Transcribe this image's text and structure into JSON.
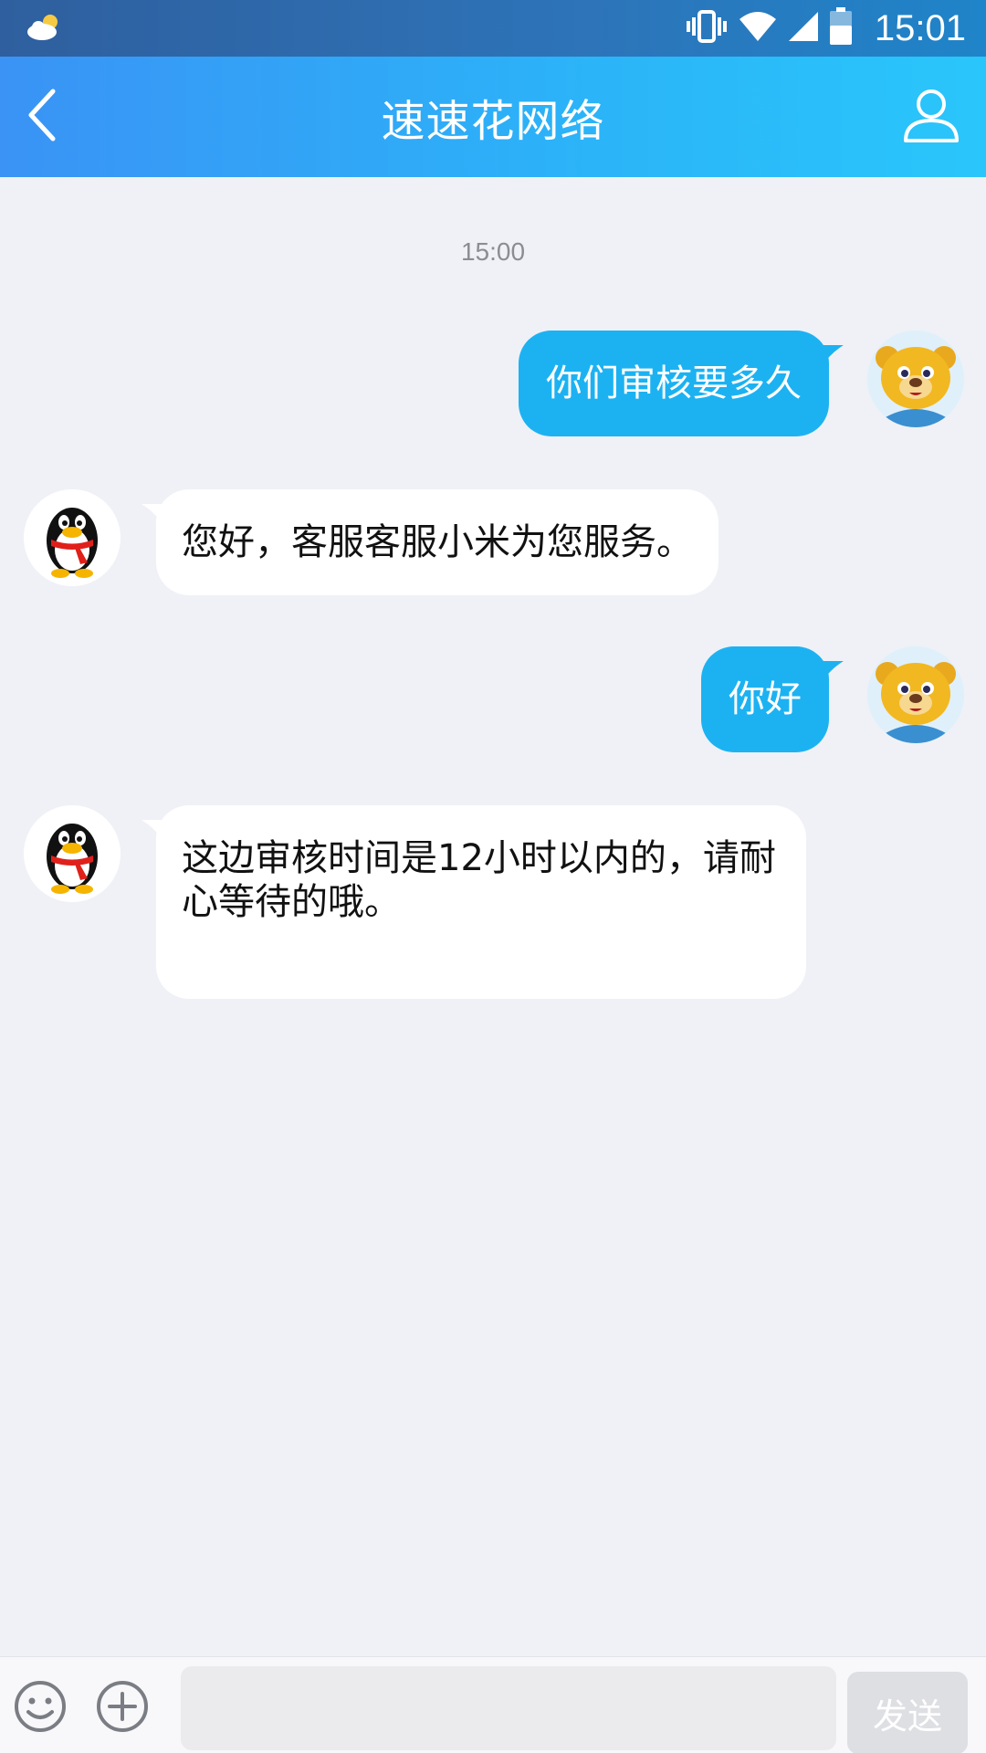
{
  "status_bar": {
    "time": "15:01"
  },
  "header": {
    "title": "速速花网络"
  },
  "chat": {
    "timestamp": "15:00",
    "messages": [
      {
        "side": "out",
        "text": "你们审核要多久"
      },
      {
        "side": "in",
        "text": "您好，客服客服小米为您服务。"
      },
      {
        "side": "out",
        "text": "你好"
      },
      {
        "side": "in",
        "text": "这边审核时间是12小时以内的，请耐心等待的哦。"
      }
    ]
  },
  "input_bar": {
    "input_value": "",
    "send_label": "发送"
  },
  "colors": {
    "header_gradient_start": "#3a93f5",
    "header_gradient_end": "#2ac6fb",
    "outgoing_bubble": "#1cb2f2",
    "incoming_bubble": "#ffffff",
    "background": "#eff1f6"
  },
  "icons": [
    "weather-icon",
    "vibrate-icon",
    "wifi-icon",
    "signal-icon",
    "battery-icon",
    "back-icon",
    "profile-icon",
    "bear-avatar",
    "penguin-avatar",
    "emoji-icon",
    "plus-icon"
  ]
}
